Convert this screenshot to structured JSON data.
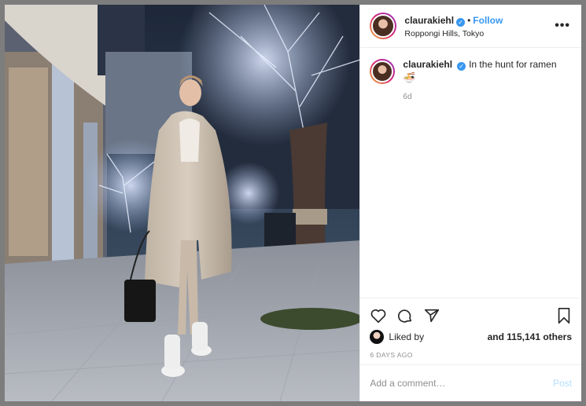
{
  "post": {
    "username": "claurakiehl",
    "follow_label": "Follow",
    "location": "Roppongi Hills, Tokyo",
    "more_label": "•••",
    "caption_text": "In the hunt for ramen",
    "caption_emoji": "🍜",
    "caption_age": "6d",
    "liked_by_label": "Liked by",
    "others_label": "and 115,141 others",
    "date_label": "6 DAYS AGO",
    "comment_placeholder": "Add a comment…",
    "post_label": "Post"
  },
  "icons": [
    "verified-badge-icon",
    "heart-icon",
    "comment-icon",
    "share-icon",
    "bookmark-icon",
    "more-options-icon"
  ],
  "colors": {
    "link": "#3897f0",
    "muted": "#8e8e8e",
    "post_disabled": "#b2dffc"
  }
}
